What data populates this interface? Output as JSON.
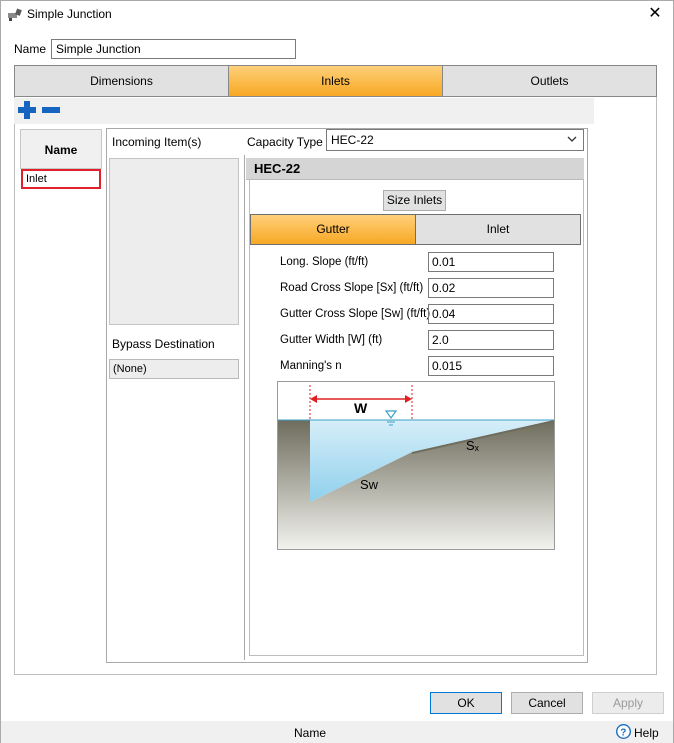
{
  "window": {
    "title": "Simple Junction",
    "close": "✕"
  },
  "name_field": {
    "label": "Name",
    "value": "Simple Junction"
  },
  "tabs": [
    {
      "label": "Dimensions"
    },
    {
      "label": "Inlets"
    },
    {
      "label": "Outlets"
    }
  ],
  "list": {
    "header": "Name",
    "items": [
      {
        "label": "Inlet"
      }
    ]
  },
  "incoming": {
    "label": "Incoming Item(s)"
  },
  "bypass": {
    "label": "Bypass Destination",
    "value": "(None)"
  },
  "capacity": {
    "label": "Capacity Type",
    "value": "HEC-22"
  },
  "hec_header": "HEC-22",
  "size_button": "Size Inlets",
  "subtabs": [
    {
      "label": "Gutter"
    },
    {
      "label": "Inlet"
    }
  ],
  "params": [
    {
      "label": "Long. Slope (ft/ft)",
      "value": "0.01"
    },
    {
      "label": "Road Cross Slope [Sx] (ft/ft)",
      "value": "0.02"
    },
    {
      "label": "Gutter Cross Slope [Sw] (ft/ft)",
      "value": "0.04"
    },
    {
      "label": "Gutter Width [W] (ft)",
      "value": "2.0"
    },
    {
      "label": "Manning's n",
      "value": "0.015"
    }
  ],
  "diagram": {
    "w_label": "W",
    "sx_label": "Sₓ",
    "sw_label": "Sw",
    "colors": {
      "ground": "#6e6c5c",
      "water": "#a8d8ee",
      "dimension": "#e02020"
    }
  },
  "buttons": {
    "ok": "OK",
    "cancel": "Cancel",
    "apply": "Apply"
  },
  "status": {
    "name": "Name",
    "help": "Help"
  },
  "colors": {
    "accent_tab": "#f7a823",
    "selected_border": "#e0202a",
    "toolbar_icon": "#1565c0"
  }
}
